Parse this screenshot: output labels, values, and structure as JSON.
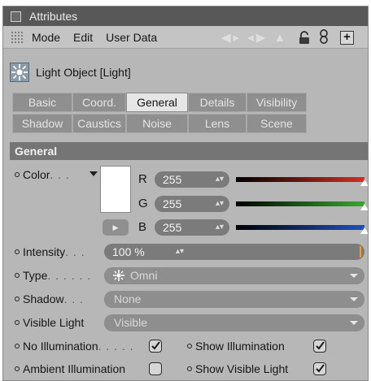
{
  "window": {
    "title": "Attributes"
  },
  "menu": {
    "items": [
      "Mode",
      "Edit",
      "User Data"
    ],
    "nav_arrows": "◀▸ ◂▶ ▲"
  },
  "object": {
    "name": "Light Object [Light]"
  },
  "tabs": {
    "row1": [
      "Basic",
      "Coord.",
      "General",
      "Details",
      "Visibility"
    ],
    "row2": [
      "Shadow",
      "Caustics",
      "Noise",
      "Lens",
      "Scene"
    ],
    "active": "General"
  },
  "section": {
    "title": "General"
  },
  "color": {
    "label": "Color",
    "dots": ". . .",
    "swatch": "#ffffff",
    "r_label": "R",
    "r_value": "255",
    "g_label": "G",
    "g_value": "255",
    "b_label": "B",
    "b_value": "255"
  },
  "intensity": {
    "label": "Intensity",
    "dots": ". . .",
    "value": "100 %"
  },
  "type": {
    "label": "Type",
    "dots": ". . . . . .",
    "value": "Omni"
  },
  "shadow": {
    "label": "Shadow",
    "dots": ". . .",
    "value": "None"
  },
  "visible_light": {
    "label": "Visible Light",
    "value": "Visible"
  },
  "checks": {
    "no_illumination": {
      "label": "No Illumination",
      "dots": ". . . . .",
      "checked": true
    },
    "show_illumination": {
      "label": "Show Illumination",
      "checked": true
    },
    "ambient_illumination": {
      "label": "Ambient Illumination",
      "checked": false
    },
    "show_visible_light": {
      "label": "Show Visible Light",
      "checked": true
    }
  },
  "colors": {
    "red_slider": "#d23020",
    "green_slider": "#3aa830",
    "blue_slider": "#2050c0",
    "header_bg": "#757575",
    "title_bg": "#585858"
  }
}
